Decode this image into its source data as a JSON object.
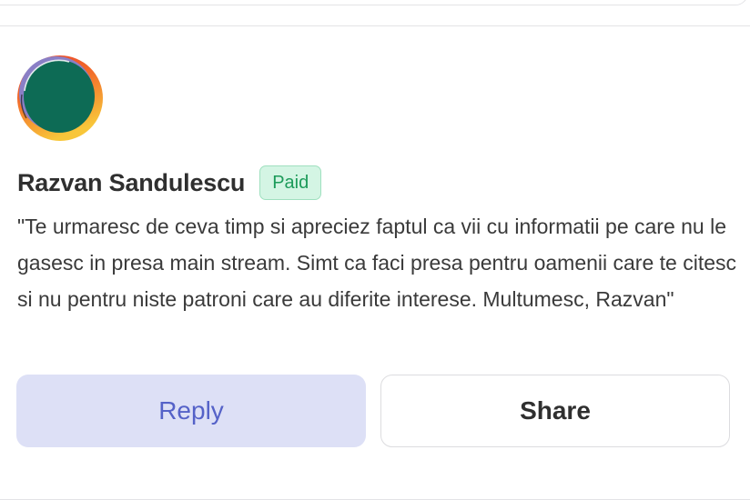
{
  "comment": {
    "author": "Razvan Sandulescu",
    "badge": "Paid",
    "text": "\"Te urmaresc de ceva timp si apreciez faptul ca vii cu informatii pe care nu le gasesc in presa main stream. Simt ca faci presa pentru oamenii care te citesc si nu pentru niste patroni care au diferite interese. Multumesc, Razvan\"",
    "avatar_icon": "gradient-circle-avatar"
  },
  "actions": {
    "reply_label": "Reply",
    "share_label": "Share"
  },
  "colors": {
    "badge_bg": "#d4f5e4",
    "badge_text": "#1c9b5a",
    "reply_bg": "#dde0f6",
    "reply_text": "#5562c8",
    "avatar_green": "#0d6b55",
    "avatar_orange": "#f0592a",
    "avatar_yellow": "#f7c230",
    "avatar_purple": "#8a7fc6"
  }
}
